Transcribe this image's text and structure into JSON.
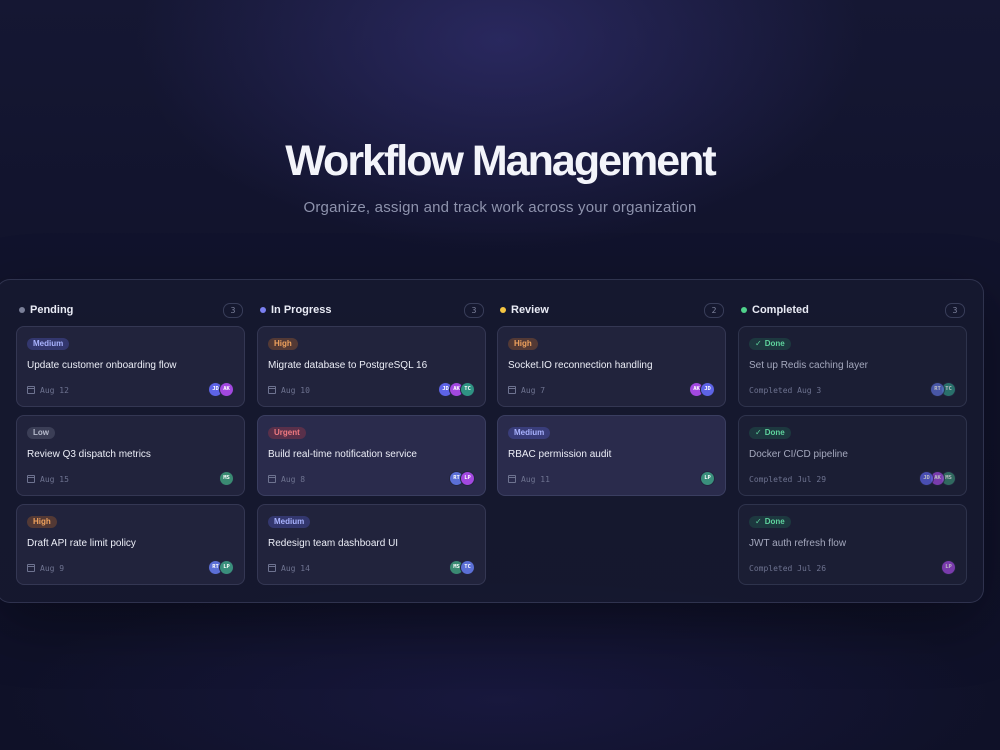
{
  "hero": {
    "title": "Workflow Management",
    "subtitle": "Organize, assign and track work across your organization"
  },
  "colors": {
    "pending": "#7a7f98",
    "in_progress": "#7a7ff0",
    "review": "#f5c542",
    "completed": "#4fd18b"
  },
  "columns": [
    {
      "title": "Pending",
      "count": "3",
      "cards": [
        {
          "badge": "Medium",
          "title": "Update customer onboarding flow",
          "date": "Aug 12",
          "avatars": [
            "JD",
            "AK"
          ]
        },
        {
          "badge": "Low",
          "title": "Review Q3 dispatch metrics",
          "date": "Aug 15",
          "avatars": [
            "MS"
          ]
        },
        {
          "badge": "High",
          "title": "Draft API rate limit policy",
          "date": "Aug 9",
          "avatars": [
            "RT",
            "LP"
          ]
        }
      ]
    },
    {
      "title": "In Progress",
      "count": "3",
      "cards": [
        {
          "badge": "High",
          "title": "Migrate database to PostgreSQL 16",
          "date": "Aug 10",
          "avatars": [
            "JD",
            "AK",
            "TC"
          ]
        },
        {
          "badge": "Urgent",
          "title": "Build real-time notification service",
          "date": "Aug 8",
          "avatars": [
            "RT",
            "LP"
          ]
        },
        {
          "badge": "Medium",
          "title": "Redesign team dashboard UI",
          "date": "Aug 14",
          "avatars": [
            "MS",
            "TC"
          ]
        }
      ]
    },
    {
      "title": "Review",
      "count": "2",
      "cards": [
        {
          "badge": "High",
          "title": "Socket.IO reconnection handling",
          "date": "Aug 7",
          "avatars": [
            "AK",
            "JD"
          ]
        },
        {
          "badge": "Medium",
          "title": "RBAC permission audit",
          "date": "Aug 11",
          "avatars": [
            "LP"
          ]
        }
      ]
    },
    {
      "title": "Completed",
      "count": "3",
      "cards": [
        {
          "badge": "Done",
          "title": "Set up Redis caching layer",
          "date": "Completed Aug 3",
          "avatars": [
            "RT",
            "TC"
          ]
        },
        {
          "badge": "Done",
          "title": "Docker CI/CD pipeline",
          "date": "Completed Jul 29",
          "avatars": [
            "JD",
            "AK",
            "MS"
          ]
        },
        {
          "badge": "Done",
          "title": "JWT auth refresh flow",
          "date": "Completed Jul 26",
          "avatars": [
            "LP"
          ]
        }
      ]
    }
  ]
}
